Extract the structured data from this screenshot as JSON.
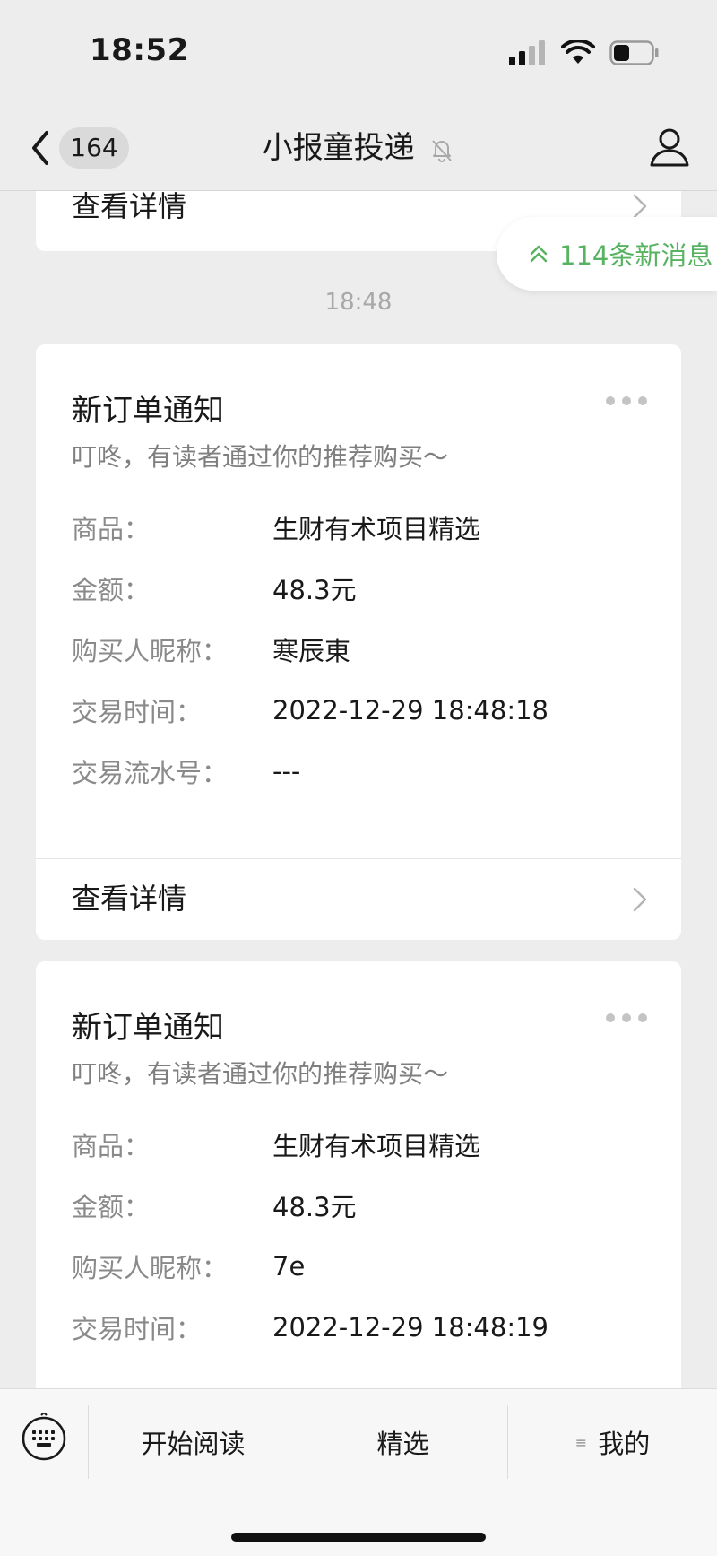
{
  "status_bar": {
    "time": "18:52"
  },
  "nav": {
    "back_count": "164",
    "title": "小报童投递"
  },
  "new_messages": {
    "label": "114条新消息"
  },
  "timestamp": "18:48",
  "partial_card": {
    "detail_label": "查看详情"
  },
  "cards": [
    {
      "title": "新订单通知",
      "subtitle": "叮咚，有读者通过你的推荐购买～",
      "fields": [
        {
          "key": "商品：",
          "value": "生财有术项目精选"
        },
        {
          "key": "金额：",
          "value": "48.3元"
        },
        {
          "key": "购买人昵称：",
          "value": "寒辰東"
        },
        {
          "key": "交易时间：",
          "value": "2022-12-29 18:48:18"
        },
        {
          "key": "交易流水号：",
          "value": "---"
        }
      ],
      "detail_label": "查看详情"
    },
    {
      "title": "新订单通知",
      "subtitle": "叮咚，有读者通过你的推荐购买～",
      "fields": [
        {
          "key": "商品：",
          "value": "生财有术项目精选"
        },
        {
          "key": "金额：",
          "value": "48.3元"
        },
        {
          "key": "购买人昵称：",
          "value": "7e"
        },
        {
          "key": "交易时间：",
          "value": "2022-12-29 18:48:19"
        }
      ]
    }
  ],
  "bottom_menu": {
    "items": [
      {
        "label": "开始阅读"
      },
      {
        "label": "精选"
      },
      {
        "label": "我的",
        "prefix": "≡"
      }
    ]
  },
  "colors": {
    "accent_green": "#57b361",
    "background": "#ededed"
  }
}
